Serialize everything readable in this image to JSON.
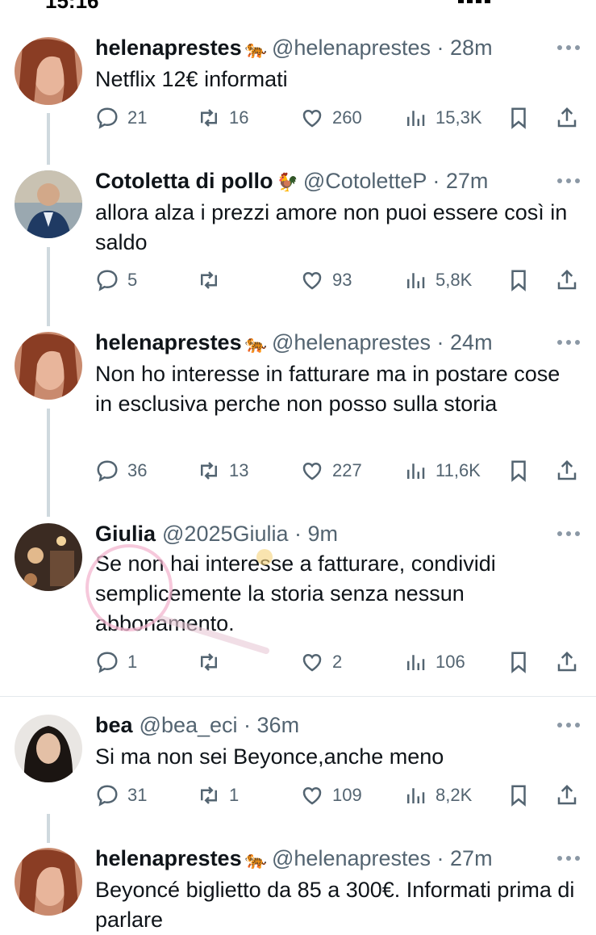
{
  "status_bar": {
    "time": "15:16"
  },
  "tweets": [
    {
      "name": "helenaprestes",
      "emoji": "🐅",
      "handle": "@helenaprestes",
      "time": "28m",
      "text": "Netflix 12€  informati",
      "replies": "21",
      "retweets": "16",
      "likes": "260",
      "views": "15,3K"
    },
    {
      "name": "Cotoletta di pollo",
      "emoji": "🐓",
      "handle": "@CotolettеP",
      "time": "27m",
      "text": "allora alza i prezzi amore non puoi essere così in saldo",
      "replies": "5",
      "retweets": "",
      "likes": "93",
      "views": "5,8K"
    },
    {
      "name": "helenaprestes",
      "emoji": "🐅",
      "handle": "@helenaprestes",
      "time": "24m",
      "text": "Non ho interesse in fatturare ma in postare cose in esclusiva perche non posso sulla storia",
      "replies": "36",
      "retweets": "13",
      "likes": "227",
      "views": "11,6K"
    },
    {
      "name": "Giulia",
      "emoji": "",
      "handle": "@2025Giulia",
      "time": "9m",
      "text": "Se non hai interesse a fatturare, condividi semplicemente la storia senza nessun abbonamento.",
      "replies": "1",
      "retweets": "",
      "likes": "2",
      "views": "106"
    },
    {
      "name": "bea",
      "emoji": "",
      "handle": "@bea_eci",
      "time": "36m",
      "text": "Si ma non sei Beyonce,anche meno",
      "replies": "31",
      "retweets": "1",
      "likes": "109",
      "views": "8,2K"
    },
    {
      "name": "helenaprestes",
      "emoji": "🐅",
      "handle": "@helenaprestes",
      "time": "27m",
      "text": "Beyoncé biglietto da 85 a 300€. Informati prima di parlare",
      "replies": "",
      "retweets": "",
      "likes": "",
      "views": ""
    }
  ],
  "colors": {
    "text": "#0f1419",
    "secondary": "#536471",
    "thread_line": "#cfd9de"
  }
}
